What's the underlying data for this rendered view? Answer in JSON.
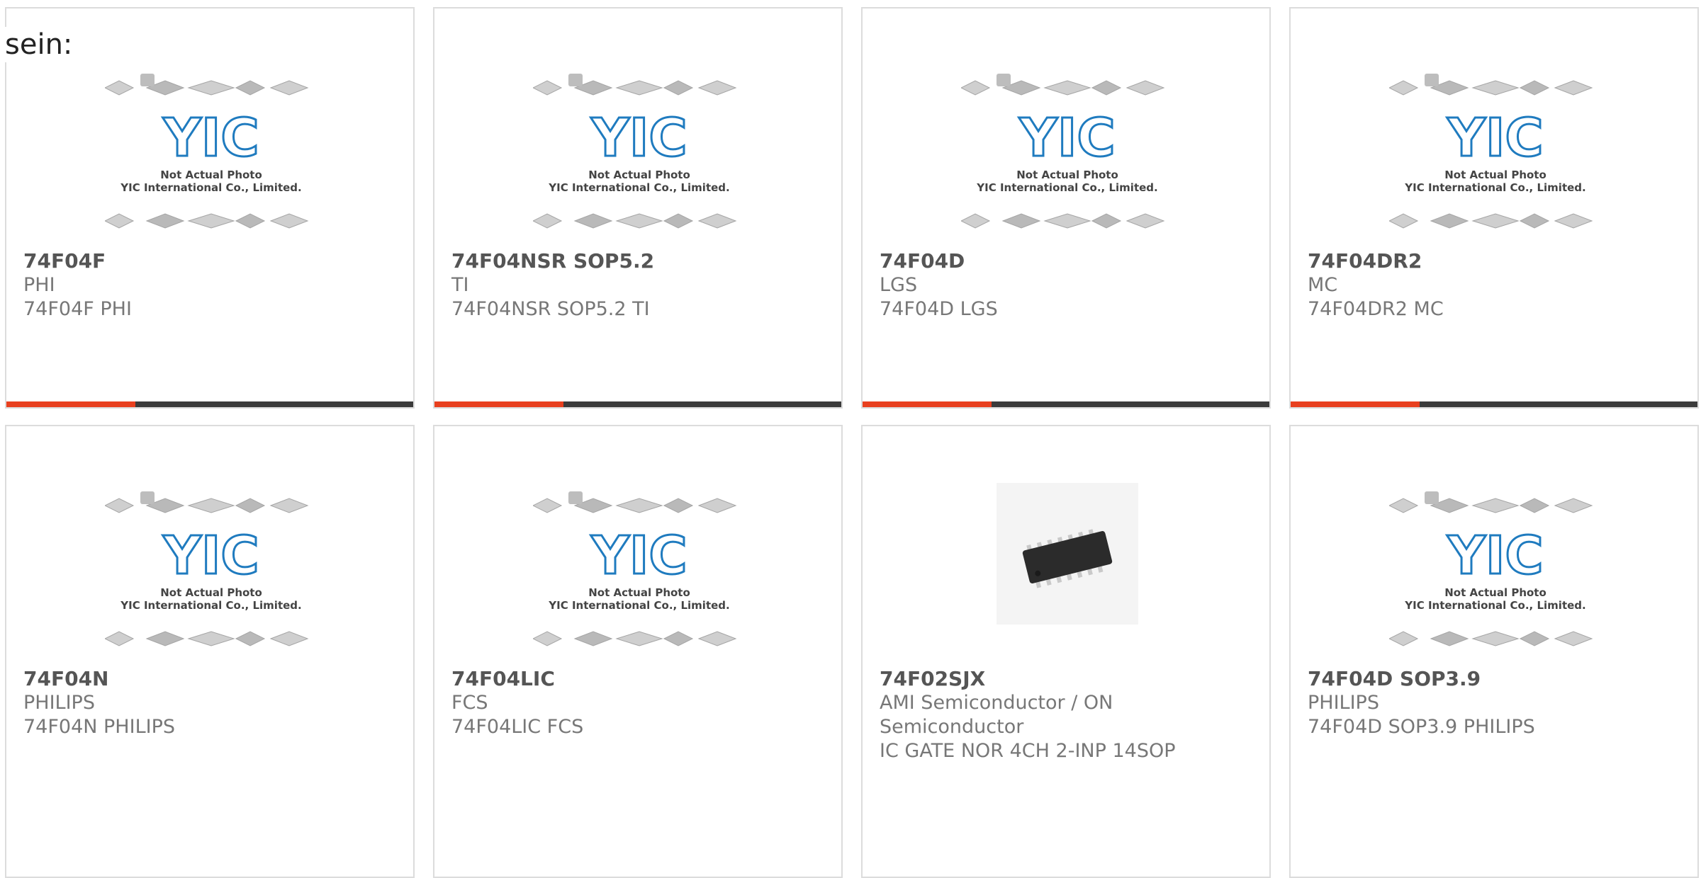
{
  "lead_text": "sein:",
  "placeholder_image": {
    "line1": "Not Actual Photo",
    "line2": "YIC International Co., Limited."
  },
  "products": [
    {
      "part": "74F04F",
      "manufacturer": "PHI",
      "description": "74F04F PHI",
      "image": "placeholder"
    },
    {
      "part": "74F04NSR SOP5.2",
      "manufacturer": "TI",
      "description": "74F04NSR SOP5.2 TI",
      "image": "placeholder"
    },
    {
      "part": "74F04D",
      "manufacturer": "LGS",
      "description": "74F04D LGS",
      "image": "placeholder"
    },
    {
      "part": "74F04DR2",
      "manufacturer": "MC",
      "description": "74F04DR2 MC",
      "image": "placeholder"
    },
    {
      "part": "74F04N",
      "manufacturer": "PHILIPS",
      "description": "74F04N PHILIPS",
      "image": "placeholder"
    },
    {
      "part": "74F04LIC",
      "manufacturer": "FCS",
      "description": "74F04LIC FCS",
      "image": "placeholder"
    },
    {
      "part": "74F02SJX",
      "manufacturer": "AMI Semiconductor / ON Semiconductor",
      "description": "IC GATE NOR 4CH 2-INP 14SOP",
      "image": "chip-photo"
    },
    {
      "part": "74F04D SOP3.9",
      "manufacturer": "PHILIPS",
      "description": "74F04D SOP3.9 PHILIPS",
      "image": "placeholder"
    }
  ],
  "colors": {
    "accent": "#e8401f",
    "bar_dark": "#3b3b3b",
    "logo_blue": "#1f7bbf",
    "card_border": "#dcdcdc"
  }
}
